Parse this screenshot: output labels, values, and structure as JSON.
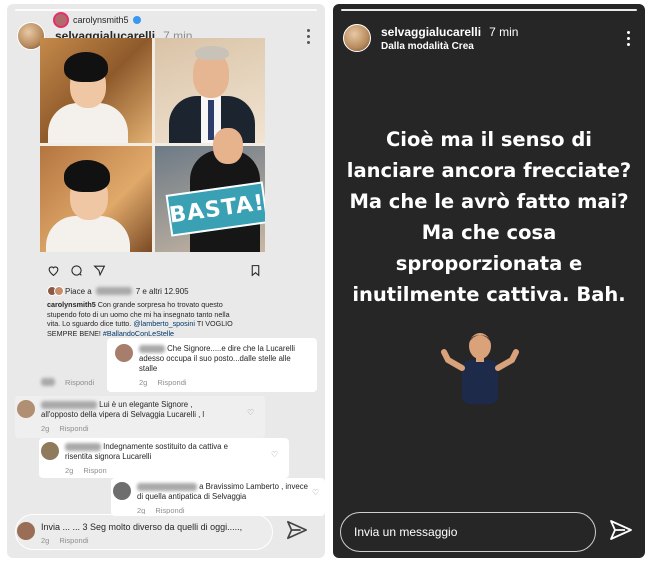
{
  "left_story": {
    "repost_user": "carolynsmith5",
    "header": {
      "username": "selvaggialucarelli",
      "time": "7 min"
    },
    "photo": {
      "badge_text": "BASTA!"
    },
    "likes": {
      "text_start": "Piace a",
      "text_end": "7 e altri 12.905"
    },
    "caption": {
      "user": "carolynsmith5",
      "line1": "Con grande sorpresa ho trovato questo",
      "line2": "stupendo foto di un uomo che mi ha insegnato tanto nella",
      "line3": "vita. Lo sguardo dice tutto.",
      "mention": "@lamberto_sposini",
      "line3b": "TI VOGLIO",
      "line4": "SEMPRE BENE!",
      "hashtag": "#BallandoConLeStelle"
    },
    "comments": [
      {
        "text1": "Che Signore.....e dire che la Lucarelli",
        "text2": "adesso occupa il suo posto...dalle stelle alle",
        "text3": "stalle",
        "time": "2g",
        "reply": "Rispondi"
      },
      {
        "prev_meta": "Rispondi",
        "text1": "Lui è un elegante Signore ,",
        "text2": "all'opposto della vipera di Selvaggia Lucarelli , l",
        "time": "2g",
        "reply": "Rispondi"
      },
      {
        "text1": "Indegnamente sostituito da cattiva e",
        "text2": "risentita signora Lucarelli",
        "time": "2g",
        "reply": "Rispon"
      },
      {
        "text1": "a Bravissimo Lamberto , invece",
        "text2": "di quella antipatica di Selvaggia",
        "time": "2g",
        "reply": "Rispondi"
      },
      {
        "text1": "Invia ... ... 3 Seg  molto diverso da quelli di oggi.....,",
        "time": "2g",
        "reply": "Rispondi"
      }
    ]
  },
  "right_story": {
    "header": {
      "username": "selvaggialucarelli",
      "time": "7 min",
      "subtitle": "Dalla modalità Crea"
    },
    "message": "Cioè ma il senso di lanciare ancora frecciate? Ma che le avrò fatto mai? Ma che cosa sproporzionata e inutilmente cattiva. Bah.",
    "reply_placeholder": "Invia un messaggio"
  },
  "colors": {
    "right_bg": "#262626",
    "left_bg": "#e9e9e9",
    "badge_bg": "#3aa0b3",
    "link": "#00376b"
  },
  "icons": [
    "kebab-menu-icon",
    "heart-icon",
    "comment-icon",
    "share-icon",
    "bookmark-icon",
    "send-icon"
  ]
}
